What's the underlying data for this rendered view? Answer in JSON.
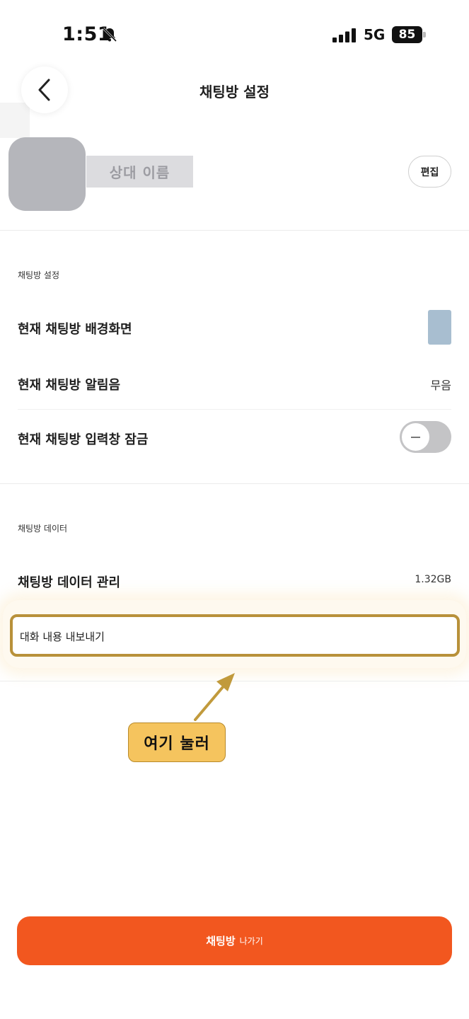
{
  "status_bar": {
    "time": "1:51",
    "network": "5G",
    "battery": "85",
    "icons": [
      "bell-slash-icon",
      "signal-icon"
    ]
  },
  "header": {
    "title": "채팅방 설정",
    "back_icon": "chevron-left-icon"
  },
  "profile": {
    "name": "상대 이름",
    "edit_label": "편집"
  },
  "chat_settings": {
    "section_label": "채팅방 설정",
    "wallpaper_label": "현재 채팅방 배경화면",
    "wallpaper_color": "#a8bed0",
    "sound_label": "현재 채팅방 알림음",
    "sound_value": "무음",
    "input_lock_label": "현재 채팅방 입력창 잠금",
    "input_lock_on": false
  },
  "chat_data": {
    "section_label": "채팅방 데이터",
    "manage_label": "채팅방 데이터 관리",
    "manage_value": "1.32GB",
    "export_label": "대화 내용 내보내기"
  },
  "annotation": {
    "hint": "여기 눌러",
    "highlight_color": "#b8913a",
    "badge_color": "#f5c45e"
  },
  "footer": {
    "leave_label_strong": "채팅방",
    "leave_label_small": "나가기",
    "leave_color": "#f2571f"
  }
}
